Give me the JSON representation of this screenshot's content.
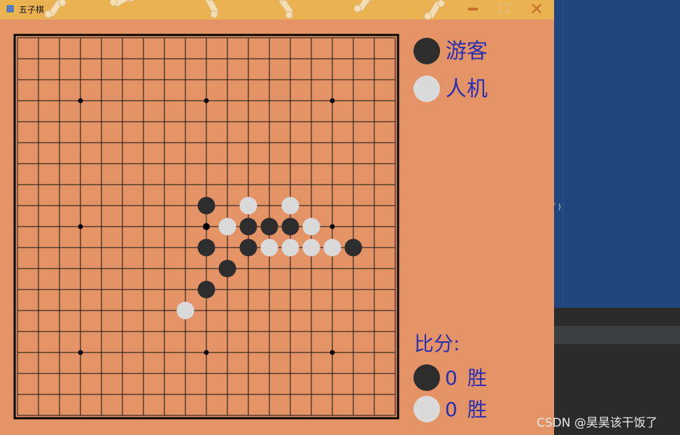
{
  "window": {
    "title": "五子棋",
    "icon": "python-icon"
  },
  "titlebar_buttons": [
    "minimize-icon",
    "maximize-icon",
    "close-icon"
  ],
  "close_glyph": "✕",
  "board": {
    "grid_size": 19,
    "star_points": [
      [
        3,
        3
      ],
      [
        3,
        9
      ],
      [
        3,
        15
      ],
      [
        9,
        3
      ],
      [
        9,
        15
      ],
      [
        15,
        3
      ],
      [
        15,
        9
      ],
      [
        15,
        15
      ]
    ],
    "last_move_marker": [
      9,
      9
    ],
    "stones": [
      {
        "row": 8,
        "col": 9,
        "color": "black"
      },
      {
        "row": 8,
        "col": 11,
        "color": "white"
      },
      {
        "row": 8,
        "col": 13,
        "color": "white"
      },
      {
        "row": 9,
        "col": 10,
        "color": "white"
      },
      {
        "row": 9,
        "col": 11,
        "color": "black"
      },
      {
        "row": 9,
        "col": 12,
        "color": "black"
      },
      {
        "row": 9,
        "col": 13,
        "color": "black"
      },
      {
        "row": 9,
        "col": 14,
        "color": "white"
      },
      {
        "row": 10,
        "col": 9,
        "color": "black"
      },
      {
        "row": 10,
        "col": 11,
        "color": "black"
      },
      {
        "row": 10,
        "col": 12,
        "color": "white"
      },
      {
        "row": 10,
        "col": 13,
        "color": "white"
      },
      {
        "row": 10,
        "col": 14,
        "color": "white"
      },
      {
        "row": 10,
        "col": 15,
        "color": "white"
      },
      {
        "row": 10,
        "col": 16,
        "color": "black"
      },
      {
        "row": 11,
        "col": 10,
        "color": "black"
      },
      {
        "row": 12,
        "col": 9,
        "color": "black"
      },
      {
        "row": 13,
        "col": 8,
        "color": "white"
      }
    ]
  },
  "players": {
    "black_label": "游客",
    "white_label": "人机"
  },
  "score": {
    "title": "比分:",
    "black_wins": "0",
    "white_wins": "0",
    "win_word": "胜"
  },
  "background": {
    "code_fragment": "`)",
    "watermark": "CSDN @昊昊该干饭了"
  },
  "colors": {
    "board_bg": "#e49367",
    "titlebar": "#ebb251",
    "label_text": "#2a2fb0",
    "black_stone": "#2d2d2d",
    "white_stone": "#dadada"
  }
}
